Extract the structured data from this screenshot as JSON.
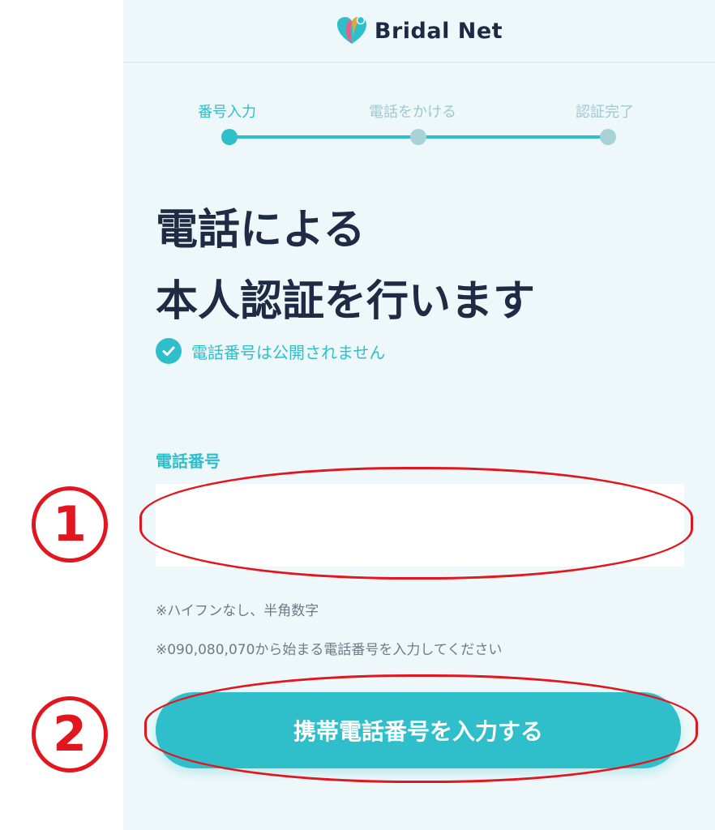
{
  "header": {
    "brand": "Bridal Net",
    "logo_icon": "heart-logo-icon"
  },
  "steps": [
    {
      "label": "番号入力",
      "state": "active"
    },
    {
      "label": "電話をかける",
      "state": "inactive"
    },
    {
      "label": "認証完了",
      "state": "inactive"
    }
  ],
  "title": {
    "line1": "電話による",
    "line2": "本人認証を行います"
  },
  "note": {
    "text": "電話番号は公開されません",
    "icon": "check-circle-icon"
  },
  "form": {
    "label": "電話番号",
    "value": "",
    "hint1": "※ハイフンなし、半角数字",
    "hint2": "※090,080,070から始まる電話番号を入力してください"
  },
  "submit": {
    "label": "携帯電話番号を入力する"
  },
  "annotations": {
    "mark1": "①",
    "mark2": "②"
  },
  "colors": {
    "accent": "#2fbfcb",
    "text": "#1f2b45",
    "panel_bg": "#eef8fa",
    "annotation": "#e2161f"
  }
}
